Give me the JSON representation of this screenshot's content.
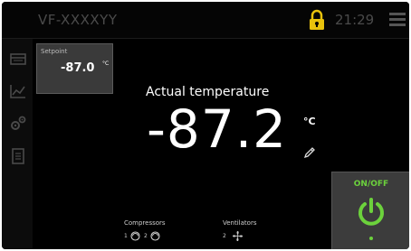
{
  "header": {
    "device_name": "VF-XXXXYY",
    "time": "21:29"
  },
  "sidebar": {
    "items": [
      {
        "icon": "refrigerator-icon"
      },
      {
        "icon": "chart-icon"
      },
      {
        "icon": "settings-icon"
      },
      {
        "icon": "document-icon"
      }
    ]
  },
  "setpoint": {
    "label": "Setpoint",
    "value": "-87.0",
    "unit": "°C"
  },
  "main": {
    "actual_label": "Actual temperature",
    "actual_value": "-87.2",
    "actual_unit": "°C"
  },
  "status": {
    "compressors": {
      "label": "Compressors",
      "items": [
        "1",
        "2"
      ]
    },
    "ventilators": {
      "label": "Ventilators",
      "items": [
        "2"
      ]
    }
  },
  "power": {
    "label": "ON/OFF",
    "state": "on"
  },
  "colors": {
    "accent_green": "#6cd23c",
    "lock_yellow": "#e8c20c",
    "background": "#000000"
  }
}
